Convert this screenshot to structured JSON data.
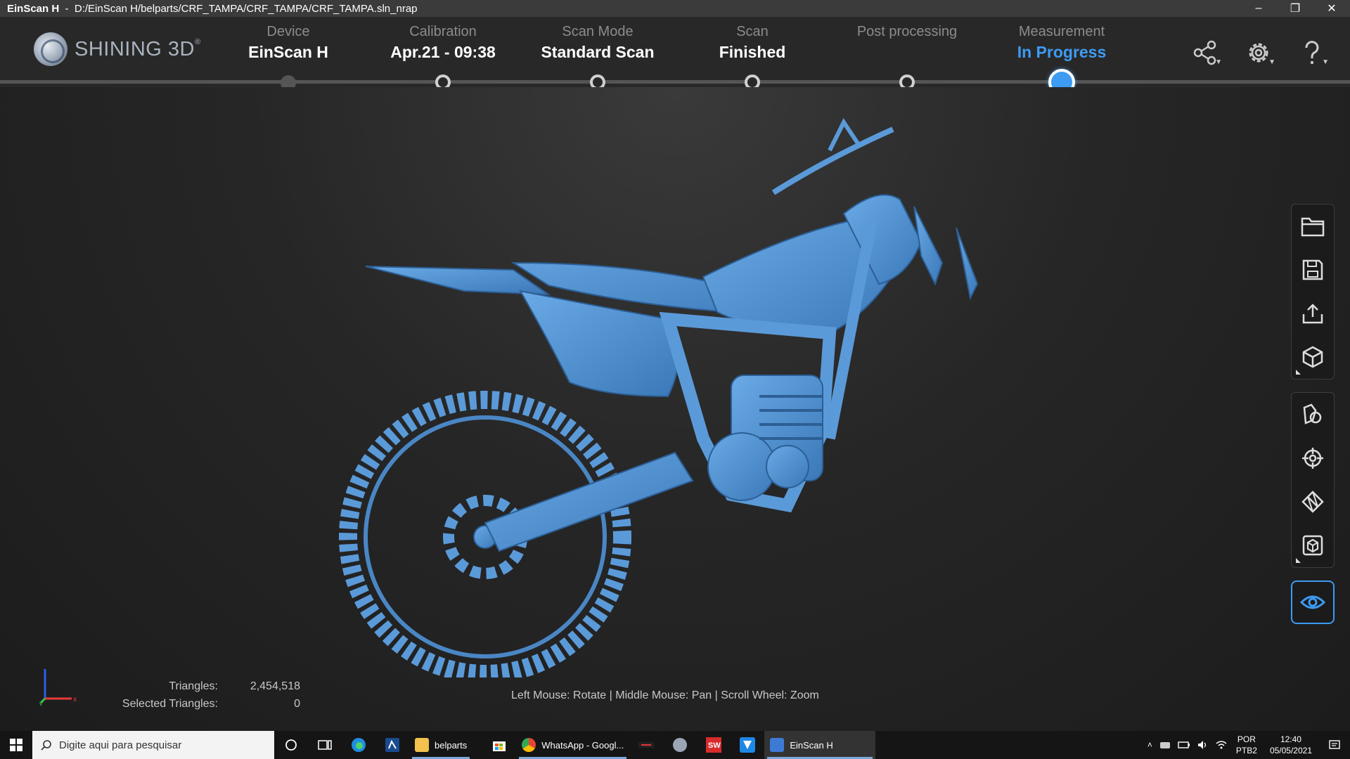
{
  "window": {
    "app_name": "EinScan H",
    "separator": "-",
    "path": "D:/EinScan H/belparts/CRF_TAMPA/CRF_TAMPA/CRF_TAMPA.sln_nrap",
    "controls": {
      "minimize": "–",
      "restore": "❐",
      "close": "✕"
    }
  },
  "logo": {
    "text": "SHINING 3D",
    "mark": "®"
  },
  "steps": [
    {
      "label": "Device",
      "value": "EinScan H",
      "state": "done"
    },
    {
      "label": "Calibration",
      "value": "Apr.21 - 09:38",
      "state": "open"
    },
    {
      "label": "Scan Mode",
      "value": "Standard Scan",
      "state": "open"
    },
    {
      "label": "Scan",
      "value": "Finished",
      "state": "open"
    },
    {
      "label": "Post processing",
      "value": "",
      "state": "open"
    },
    {
      "label": "Measurement",
      "value": "In Progress",
      "state": "active"
    }
  ],
  "header_icons": [
    "share-icon",
    "settings-icon",
    "help-icon"
  ],
  "toolbar": {
    "group1": [
      "open-folder-icon",
      "save-icon",
      "export-icon",
      "cube-view-icon"
    ],
    "group2": [
      "measure-tool-icon",
      "align-target-icon",
      "mesh-edit-icon",
      "box-select-icon"
    ],
    "active": "eye-icon"
  },
  "stats": {
    "triangles_label": "Triangles:",
    "triangles_value": "2,454,518",
    "selected_label": "Selected Triangles:",
    "selected_value": "0"
  },
  "axis": {
    "x": "x",
    "y": "y"
  },
  "hint": "Left Mouse: Rotate | Middle Mouse: Pan | Scroll Wheel: Zoom",
  "taskbar": {
    "search_placeholder": "Digite aqui para pesquisar",
    "apps": [
      {
        "label": "belparts",
        "color": "#f2c14e"
      },
      {
        "label": "WhatsApp - Googl...",
        "color": "#4285f4"
      },
      {
        "label": "EinScan H",
        "color": "#3d7ad6"
      }
    ],
    "lang_top": "POR",
    "lang_bottom": "PTB2",
    "time": "12:40",
    "date": "05/05/2021"
  },
  "colors": {
    "accent": "#3d9bf2",
    "model": "#4a8fd0",
    "background": "#1e1e1e"
  }
}
